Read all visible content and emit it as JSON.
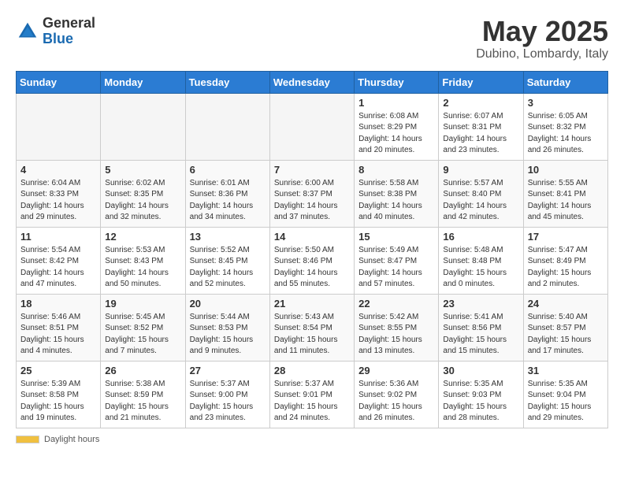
{
  "logo": {
    "general": "General",
    "blue": "Blue"
  },
  "title": "May 2025",
  "location": "Dubino, Lombardy, Italy",
  "weekdays": [
    "Sunday",
    "Monday",
    "Tuesday",
    "Wednesday",
    "Thursday",
    "Friday",
    "Saturday"
  ],
  "weeks": [
    [
      {
        "day": "",
        "info": ""
      },
      {
        "day": "",
        "info": ""
      },
      {
        "day": "",
        "info": ""
      },
      {
        "day": "",
        "info": ""
      },
      {
        "day": "1",
        "info": "Sunrise: 6:08 AM\nSunset: 8:29 PM\nDaylight: 14 hours and 20 minutes."
      },
      {
        "day": "2",
        "info": "Sunrise: 6:07 AM\nSunset: 8:31 PM\nDaylight: 14 hours and 23 minutes."
      },
      {
        "day": "3",
        "info": "Sunrise: 6:05 AM\nSunset: 8:32 PM\nDaylight: 14 hours and 26 minutes."
      }
    ],
    [
      {
        "day": "4",
        "info": "Sunrise: 6:04 AM\nSunset: 8:33 PM\nDaylight: 14 hours and 29 minutes."
      },
      {
        "day": "5",
        "info": "Sunrise: 6:02 AM\nSunset: 8:35 PM\nDaylight: 14 hours and 32 minutes."
      },
      {
        "day": "6",
        "info": "Sunrise: 6:01 AM\nSunset: 8:36 PM\nDaylight: 14 hours and 34 minutes."
      },
      {
        "day": "7",
        "info": "Sunrise: 6:00 AM\nSunset: 8:37 PM\nDaylight: 14 hours and 37 minutes."
      },
      {
        "day": "8",
        "info": "Sunrise: 5:58 AM\nSunset: 8:38 PM\nDaylight: 14 hours and 40 minutes."
      },
      {
        "day": "9",
        "info": "Sunrise: 5:57 AM\nSunset: 8:40 PM\nDaylight: 14 hours and 42 minutes."
      },
      {
        "day": "10",
        "info": "Sunrise: 5:55 AM\nSunset: 8:41 PM\nDaylight: 14 hours and 45 minutes."
      }
    ],
    [
      {
        "day": "11",
        "info": "Sunrise: 5:54 AM\nSunset: 8:42 PM\nDaylight: 14 hours and 47 minutes."
      },
      {
        "day": "12",
        "info": "Sunrise: 5:53 AM\nSunset: 8:43 PM\nDaylight: 14 hours and 50 minutes."
      },
      {
        "day": "13",
        "info": "Sunrise: 5:52 AM\nSunset: 8:45 PM\nDaylight: 14 hours and 52 minutes."
      },
      {
        "day": "14",
        "info": "Sunrise: 5:50 AM\nSunset: 8:46 PM\nDaylight: 14 hours and 55 minutes."
      },
      {
        "day": "15",
        "info": "Sunrise: 5:49 AM\nSunset: 8:47 PM\nDaylight: 14 hours and 57 minutes."
      },
      {
        "day": "16",
        "info": "Sunrise: 5:48 AM\nSunset: 8:48 PM\nDaylight: 15 hours and 0 minutes."
      },
      {
        "day": "17",
        "info": "Sunrise: 5:47 AM\nSunset: 8:49 PM\nDaylight: 15 hours and 2 minutes."
      }
    ],
    [
      {
        "day": "18",
        "info": "Sunrise: 5:46 AM\nSunset: 8:51 PM\nDaylight: 15 hours and 4 minutes."
      },
      {
        "day": "19",
        "info": "Sunrise: 5:45 AM\nSunset: 8:52 PM\nDaylight: 15 hours and 7 minutes."
      },
      {
        "day": "20",
        "info": "Sunrise: 5:44 AM\nSunset: 8:53 PM\nDaylight: 15 hours and 9 minutes."
      },
      {
        "day": "21",
        "info": "Sunrise: 5:43 AM\nSunset: 8:54 PM\nDaylight: 15 hours and 11 minutes."
      },
      {
        "day": "22",
        "info": "Sunrise: 5:42 AM\nSunset: 8:55 PM\nDaylight: 15 hours and 13 minutes."
      },
      {
        "day": "23",
        "info": "Sunrise: 5:41 AM\nSunset: 8:56 PM\nDaylight: 15 hours and 15 minutes."
      },
      {
        "day": "24",
        "info": "Sunrise: 5:40 AM\nSunset: 8:57 PM\nDaylight: 15 hours and 17 minutes."
      }
    ],
    [
      {
        "day": "25",
        "info": "Sunrise: 5:39 AM\nSunset: 8:58 PM\nDaylight: 15 hours and 19 minutes."
      },
      {
        "day": "26",
        "info": "Sunrise: 5:38 AM\nSunset: 8:59 PM\nDaylight: 15 hours and 21 minutes."
      },
      {
        "day": "27",
        "info": "Sunrise: 5:37 AM\nSunset: 9:00 PM\nDaylight: 15 hours and 23 minutes."
      },
      {
        "day": "28",
        "info": "Sunrise: 5:37 AM\nSunset: 9:01 PM\nDaylight: 15 hours and 24 minutes."
      },
      {
        "day": "29",
        "info": "Sunrise: 5:36 AM\nSunset: 9:02 PM\nDaylight: 15 hours and 26 minutes."
      },
      {
        "day": "30",
        "info": "Sunrise: 5:35 AM\nSunset: 9:03 PM\nDaylight: 15 hours and 28 minutes."
      },
      {
        "day": "31",
        "info": "Sunrise: 5:35 AM\nSunset: 9:04 PM\nDaylight: 15 hours and 29 minutes."
      }
    ]
  ],
  "footer": {
    "daylight_label": "Daylight hours"
  }
}
